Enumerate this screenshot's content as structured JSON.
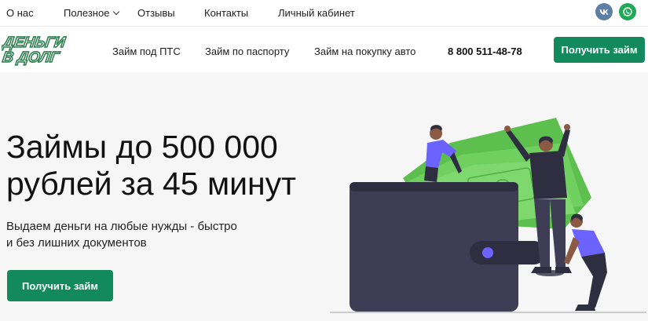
{
  "topbar": {
    "links": [
      {
        "label": "О нас"
      },
      {
        "label": "Полезное"
      },
      {
        "label": "Отзывы"
      },
      {
        "label": "Контакты"
      },
      {
        "label": "Личный кабинет"
      }
    ],
    "social": [
      {
        "name": "vk-icon",
        "label": "VK",
        "color": "#5b7fa6"
      },
      {
        "name": "whatsapp-icon",
        "color": "#1fa855"
      }
    ]
  },
  "header": {
    "logo_text_line1": "ДЕНЬГИ",
    "logo_text_line2": "В ДОЛГ",
    "nav": [
      {
        "label": "Займ под ПТС"
      },
      {
        "label": "Займ по паспорту"
      },
      {
        "label": "Займ на покупку авто"
      }
    ],
    "phone": "8 800 511-48-78",
    "cta_label": "Получить займ"
  },
  "hero": {
    "title": "Займы до 500 000 рублей за 45 минут",
    "subtitle": "Выдаем деньги на любые нужды - быстро и без лишних документов",
    "cta_label": "Получить займ"
  },
  "colors": {
    "accent": "#138a5e",
    "hero_bg": "#f6f6f6",
    "wallet": "#3f3d56",
    "money": "#6fcf5f",
    "person_accent": "#6c63ff"
  }
}
